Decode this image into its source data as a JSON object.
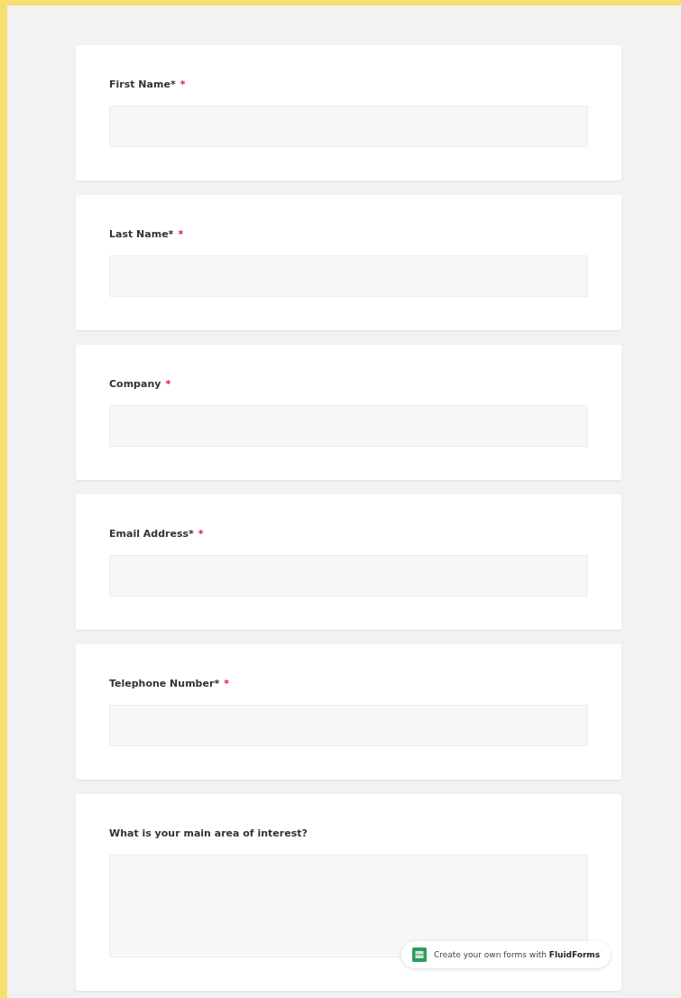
{
  "fields": [
    {
      "label": "First Name*",
      "required_mark": "*",
      "kind": "input"
    },
    {
      "label": "Last Name*",
      "required_mark": "*",
      "kind": "input"
    },
    {
      "label": "Company",
      "required_mark": "*",
      "kind": "input"
    },
    {
      "label": "Email Address*",
      "required_mark": "*",
      "kind": "input"
    },
    {
      "label": "Telephone Number*",
      "required_mark": "*",
      "kind": "input"
    },
    {
      "label": "What is your main area of interest?",
      "kind": "textarea"
    }
  ],
  "badge": {
    "text": "Create your own forms with **FluidForms**"
  }
}
